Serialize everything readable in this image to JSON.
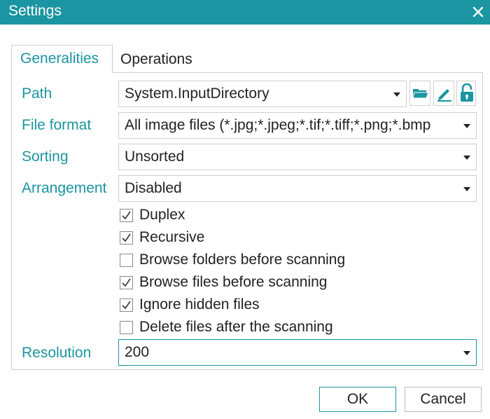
{
  "window": {
    "title": "Settings",
    "close_icon": "close-icon",
    "accent": "#1b95a1"
  },
  "tabs": [
    {
      "label": "Generalities",
      "active": true
    },
    {
      "label": "Operations",
      "active": false
    }
  ],
  "fields": {
    "path": {
      "label": "Path",
      "value": "System.InputDirectory"
    },
    "file_format": {
      "label": "File format",
      "value": "All image files (*.jpg;*.jpeg;*.tif;*.tiff;*.png;*.bmp"
    },
    "sorting": {
      "label": "Sorting",
      "value": "Unsorted"
    },
    "arrangement": {
      "label": "Arrangement",
      "value": "Disabled"
    },
    "resolution": {
      "label": "Resolution",
      "value": "200"
    }
  },
  "path_buttons": [
    {
      "icon": "folder-open-icon"
    },
    {
      "icon": "pencil-edit-icon"
    },
    {
      "icon": "unlock-icon"
    }
  ],
  "checkboxes": [
    {
      "label": "Duplex",
      "checked": true
    },
    {
      "label": "Recursive",
      "checked": true
    },
    {
      "label": "Browse folders before scanning",
      "checked": false
    },
    {
      "label": "Browse files before scanning",
      "checked": true
    },
    {
      "label": "Ignore hidden files",
      "checked": true
    },
    {
      "label": "Delete files after the scanning",
      "checked": false
    }
  ],
  "buttons": {
    "ok": "OK",
    "cancel": "Cancel"
  }
}
